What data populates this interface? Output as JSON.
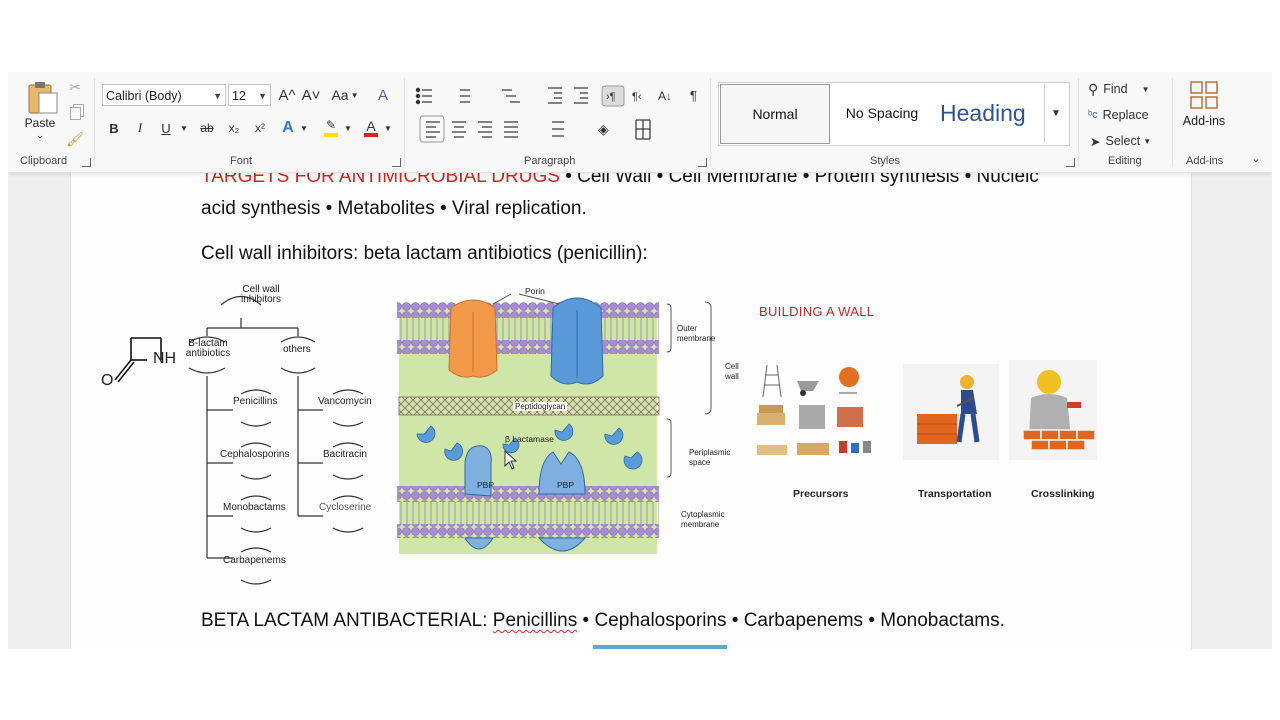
{
  "ribbon": {
    "clipboard": {
      "paste": "Paste",
      "label": "Clipboard"
    },
    "font": {
      "family": "Calibri (Body)",
      "size": "12",
      "label": "Font",
      "grow": "A^",
      "shrink": "A˅",
      "case": "Aa",
      "bold": "B",
      "italic": "I",
      "underline": "U",
      "strike": "ab",
      "subscript": "x₂",
      "superscript": "x²",
      "effects": "A",
      "font_color": "A"
    },
    "paragraph": {
      "label": "Paragraph"
    },
    "styles": {
      "label": "Styles",
      "items": [
        "Normal",
        "No Spacing",
        "Heading"
      ]
    },
    "editing": {
      "label": "Editing",
      "find": "Find",
      "replace": "Replace",
      "select": "Select"
    },
    "addins": {
      "label": "Add-ins",
      "button": "Add-ins"
    }
  },
  "doc": {
    "line1_red": "TARGETS FOR ANTIMICROBIAL DRUGS",
    "line1_rest": " • Cell Wall • Cell Membrane • Protein synthesis • Nucleic",
    "line2": "acid synthesis • Metabolites • Viral replication.",
    "heading": "Cell wall inhibitors: beta lactam antibiotics (penicillin):",
    "bottom_prefix": "BETA LACTAM ANTIBACTERIAL: ",
    "bottom_pen": "Penicillins",
    "bottom_rest": " • Cephalosporins • Carbapenems • Monobactams."
  },
  "tree": {
    "root": "Cell wall inhibitors",
    "left_head": "B-lactam antibiotics",
    "right_head": "others",
    "left": [
      "Penicillins",
      "Cephalosporins",
      "Monobactams",
      "Carbapenems"
    ],
    "right": [
      "Vancomycin",
      "Bacitracin",
      "Cycloserine"
    ],
    "nh": "NH",
    "o": "O"
  },
  "membrane": {
    "porin": "Porin",
    "outer": "Outer membrane",
    "cell_wall": "Cell wall",
    "peptidoglycan": "Peptidoglycan",
    "lactamase": "β Lactamase",
    "periplasmic": "Periplasmic space",
    "pbp": "PBP",
    "cytoplasmic": "Cytoplasmic membrane"
  },
  "wall": {
    "title": "BUILDING A WALL",
    "captions": [
      "Precursors",
      "Transportation",
      "Crosslinking"
    ]
  },
  "colors": {
    "accent_red": "#d0281e",
    "heading_blue": "#2f5496",
    "membrane_green": "#cfe6a8",
    "lipid_purple": "#a98ad6"
  }
}
